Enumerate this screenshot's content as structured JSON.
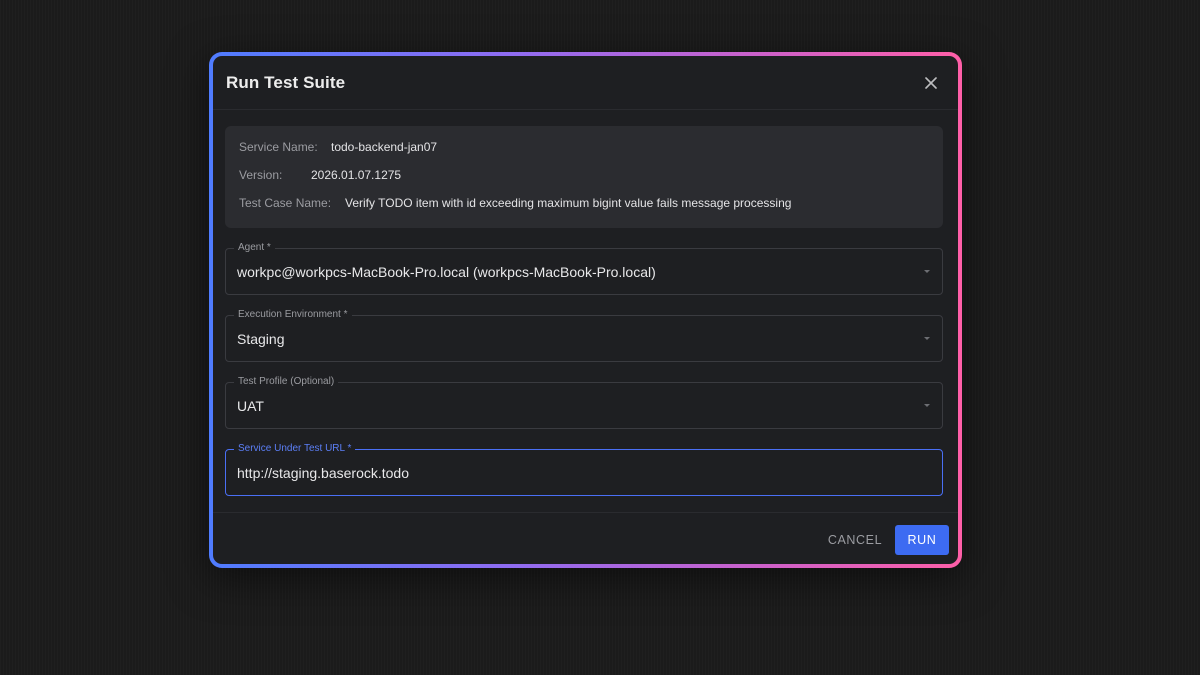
{
  "colors": {
    "accent": "#3d6bf2",
    "focus_border": "#4a6ff5",
    "gradient_start": "#4f7cff",
    "gradient_end": "#ff5fa8"
  },
  "dialog": {
    "title": "Run Test Suite",
    "close_icon": "close-icon"
  },
  "info": {
    "service_name_label": "Service Name:",
    "service_name": "todo-backend-jan07",
    "version_label": "Version:",
    "version": "2026.01.07.1275",
    "test_case_label": "Test Case Name:",
    "test_case": "Verify TODO item with id exceeding maximum bigint value fails message processing"
  },
  "fields": {
    "agent": {
      "label": "Agent *",
      "value": "workpc@workpcs-MacBook-Pro.local (workpcs-MacBook-Pro.local)"
    },
    "environment": {
      "label": "Execution Environment *",
      "value": "Staging"
    },
    "profile": {
      "label": "Test Profile (Optional)",
      "value": "UAT"
    },
    "url": {
      "label": "Service Under Test URL *",
      "value": "http://staging.baserock.todo"
    }
  },
  "actions": {
    "cancel": "CANCEL",
    "run": "RUN"
  }
}
